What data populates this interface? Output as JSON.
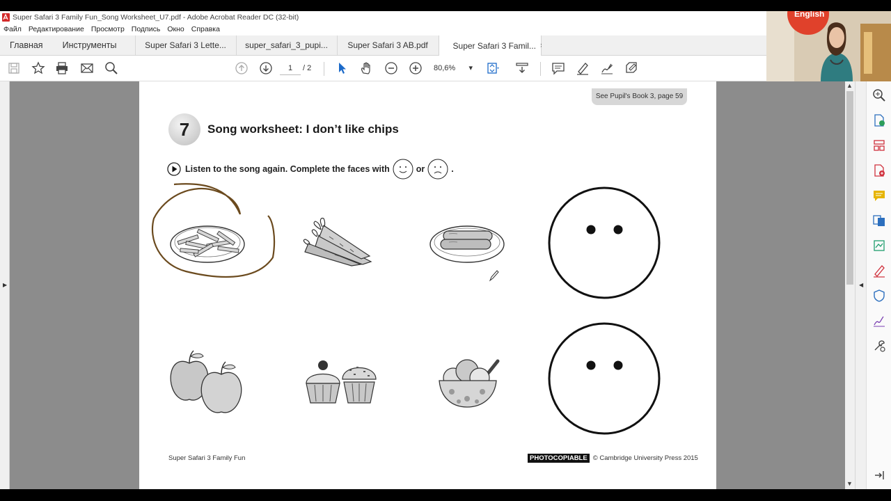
{
  "window": {
    "title": "Super Safari 3 Family Fun_Song Worksheet_U7.pdf - Adobe Acrobat Reader DC (32-bit)"
  },
  "menu": [
    "Файл",
    "Редактирование",
    "Просмотр",
    "Подпись",
    "Окно",
    "Справка"
  ],
  "tabs": {
    "home": "Главная",
    "tools": "Инструменты",
    "docs": [
      {
        "label": "Super Safari 3 Lette..."
      },
      {
        "label": "super_safari_3_pupi..."
      },
      {
        "label": "Super Safari 3 AB.pdf"
      },
      {
        "label": "Super Safari 3 Famil..."
      }
    ],
    "close_glyph": "×"
  },
  "toolbar": {
    "page_current": "1",
    "page_total": "/ 2",
    "zoom": "80,6%",
    "zoom_caret": "▾"
  },
  "document": {
    "see_note": "See Pupil's Book 3, page 59",
    "activity_number": "7",
    "title": "Song worksheet: I don’t like chips",
    "instruction": "Listen to the song again. Complete the faces with",
    "instruction_or": "or",
    "instruction_end": ".",
    "footer_left": "Super Safari 3 Family Fun",
    "footer_badge": "PHOTOCOPIABLE",
    "footer_copyright": "© Cambridge University Press 2015",
    "images": [
      "chips",
      "carrots",
      "sausages",
      "apples",
      "cupcakes",
      "ice cream"
    ]
  },
  "colors": {
    "annotation_circle": "#6b4a1e",
    "tools_icons": [
      "#2c6fbe",
      "#d0313d",
      "#e6b400",
      "#7a3fb1",
      "#1f9e6e"
    ]
  }
}
